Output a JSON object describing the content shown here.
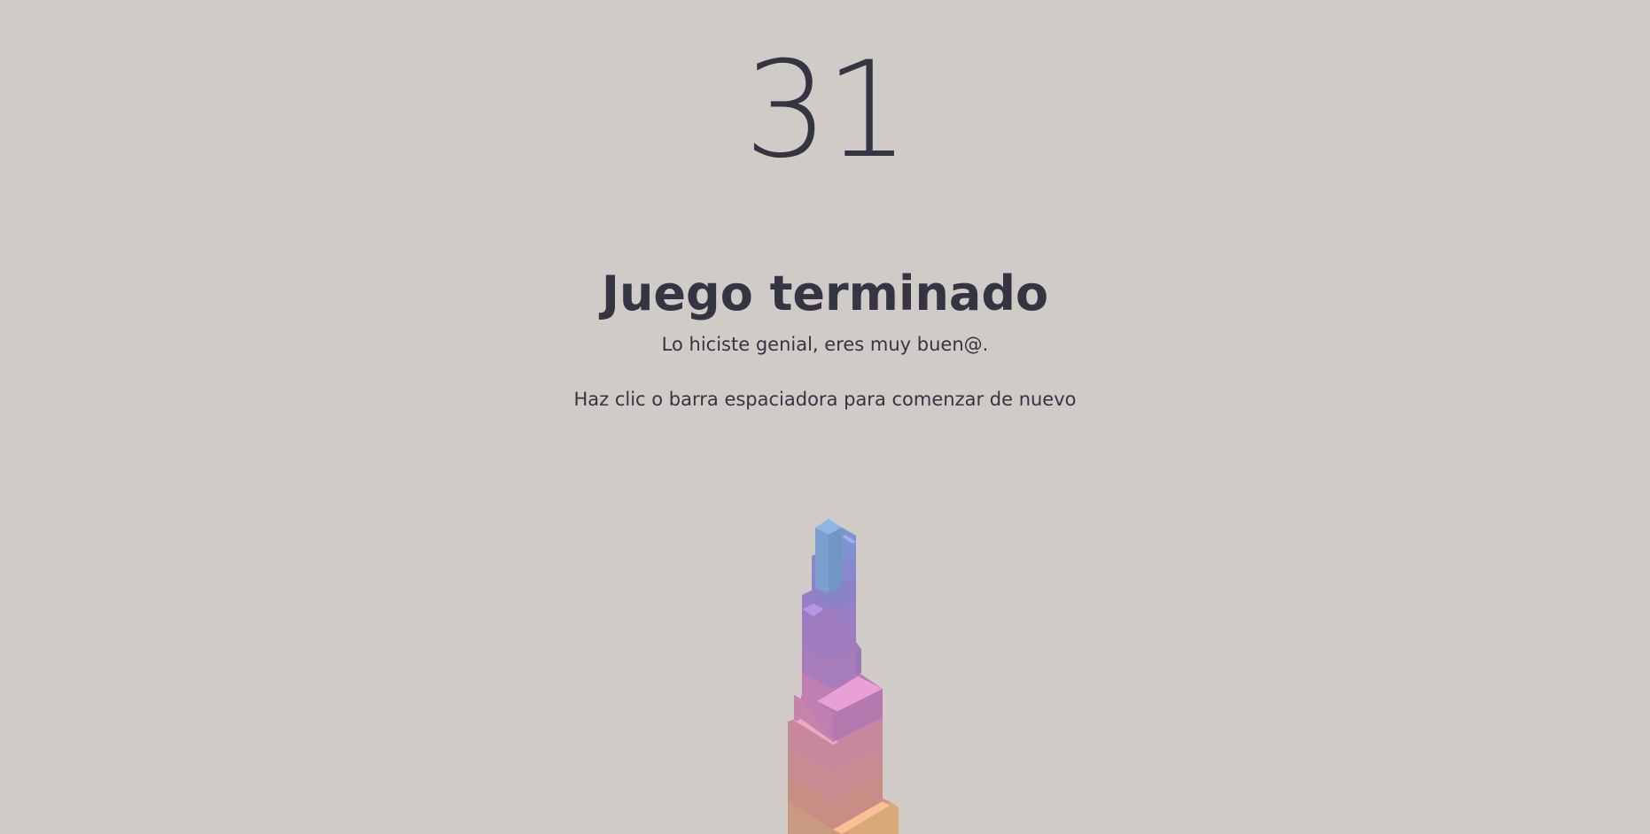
{
  "game": {
    "score": "31",
    "game_over_title": "Juego terminado",
    "game_over_message": "Lo hiciste genial, eres muy buen@.",
    "restart_hint": "Haz clic o barra espaciadora para comenzar de nuevo"
  },
  "colors": {
    "background": "#d0cbc7",
    "text": "#353443"
  },
  "tower": {
    "block_colors": [
      "#7fa9d6",
      "#8496d2",
      "#8e86cc",
      "#9a7fc8",
      "#a97cbf",
      "#c680b4",
      "#d98aa6",
      "#cf8f8f",
      "#c99a7f",
      "#d7a870"
    ]
  }
}
